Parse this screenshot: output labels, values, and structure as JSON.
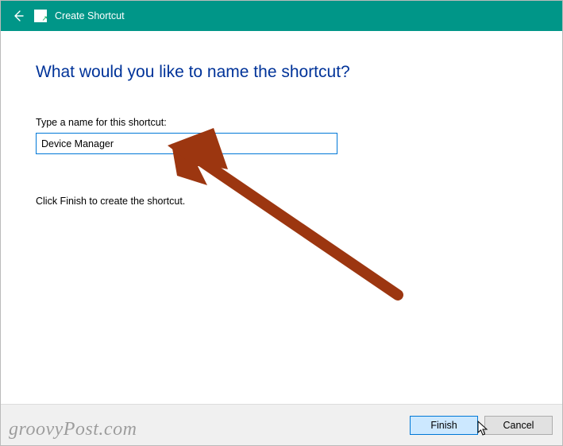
{
  "window": {
    "title": "Create Shortcut"
  },
  "main": {
    "heading": "What would you like to name the shortcut?",
    "label": "Type a name for this shortcut:",
    "input_value": "Device Manager",
    "hint": "Click Finish to create the shortcut."
  },
  "footer": {
    "finish_label": "Finish",
    "cancel_label": "Cancel"
  },
  "watermark": "groovyPost.com",
  "colors": {
    "titlebar": "#009688",
    "heading": "#003399",
    "input_border": "#0078d7",
    "primary_btn_bg": "#cce8ff",
    "arrow": "#9c3610"
  }
}
